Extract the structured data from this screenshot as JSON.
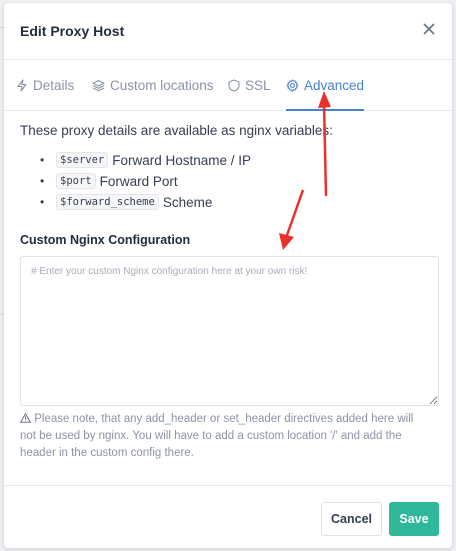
{
  "modal": {
    "title": "Edit Proxy Host",
    "close_icon": "close-icon"
  },
  "tabs": [
    {
      "label": "Details",
      "icon": "bolt-icon",
      "active": false
    },
    {
      "label": "Custom locations",
      "icon": "layers-icon",
      "active": false
    },
    {
      "label": "SSL",
      "icon": "shield-icon",
      "active": false
    },
    {
      "label": "Advanced",
      "icon": "gear-icon",
      "active": true
    }
  ],
  "advanced": {
    "intro": "These proxy details are available as nginx variables:",
    "variables": [
      {
        "code": "$server",
        "desc": "Forward Hostname / IP"
      },
      {
        "code": "$port",
        "desc": "Forward Port"
      },
      {
        "code": "$forward_scheme",
        "desc": "Scheme"
      }
    ],
    "config_label": "Custom Nginx Configuration",
    "config_placeholder": "# Enter your custom Nginx configuration here at your own risk!",
    "config_value": "",
    "note": "Please note, that any add_header or set_header directives added here will not be used by nginx. You will have to add a custom location '/' and add the header in the custom config there."
  },
  "footer": {
    "cancel_label": "Cancel",
    "save_label": "Save"
  },
  "colors": {
    "accent": "#467fcf",
    "save": "#2fb99a",
    "annotation_arrow": "#e8312a"
  }
}
